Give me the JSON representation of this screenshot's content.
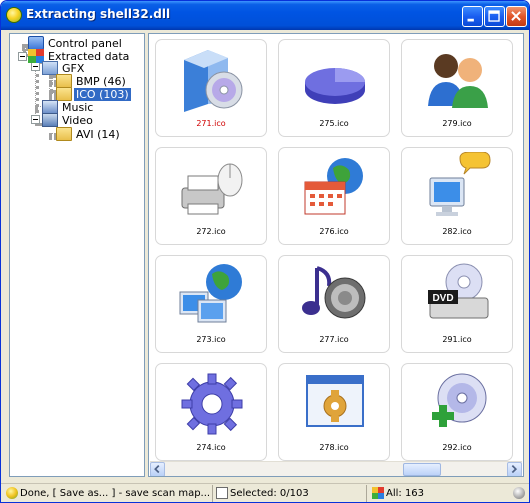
{
  "window": {
    "title": "Extracting shell32.dll"
  },
  "tree": {
    "items": [
      {
        "label": "Control panel",
        "icon": "control-panel-icon"
      },
      {
        "label": "Extracted data",
        "icon": "extracted-data-icon"
      },
      {
        "label": "GFX",
        "icon": "gfx-icon"
      },
      {
        "label": "BMP (46)",
        "icon": "bmp-folder-icon"
      },
      {
        "label": "ICO (103)",
        "icon": "ico-folder-icon",
        "selected": true
      },
      {
        "label": "Music",
        "icon": "music-icon"
      },
      {
        "label": "Video",
        "icon": "video-icon"
      },
      {
        "label": "AVI (14)",
        "icon": "avi-folder-icon"
      }
    ]
  },
  "grid": {
    "items": [
      {
        "label": "271.ico",
        "icon": "software-install-icon",
        "highlight": true
      },
      {
        "label": "275.ico",
        "icon": "pie-chart-icon"
      },
      {
        "label": "279.ico",
        "icon": "users-icon"
      },
      {
        "label": "272.ico",
        "icon": "printer-mouse-icon"
      },
      {
        "label": "276.ico",
        "icon": "calendar-globe-icon"
      },
      {
        "label": "282.ico",
        "icon": "monitor-chat-icon"
      },
      {
        "label": "273.ico",
        "icon": "network-computers-icon"
      },
      {
        "label": "277.ico",
        "icon": "music-speaker-icon"
      },
      {
        "label": "291.ico",
        "icon": "dvd-drive-icon"
      },
      {
        "label": "274.ico",
        "icon": "gear-icon"
      },
      {
        "label": "278.ico",
        "icon": "window-gear-icon"
      },
      {
        "label": "292.ico",
        "icon": "cd-add-icon"
      }
    ]
  },
  "status": {
    "message": "Done, [ Save as... ] - save scan map...",
    "selected": "Selected: 0/103",
    "all": "All: 163"
  }
}
